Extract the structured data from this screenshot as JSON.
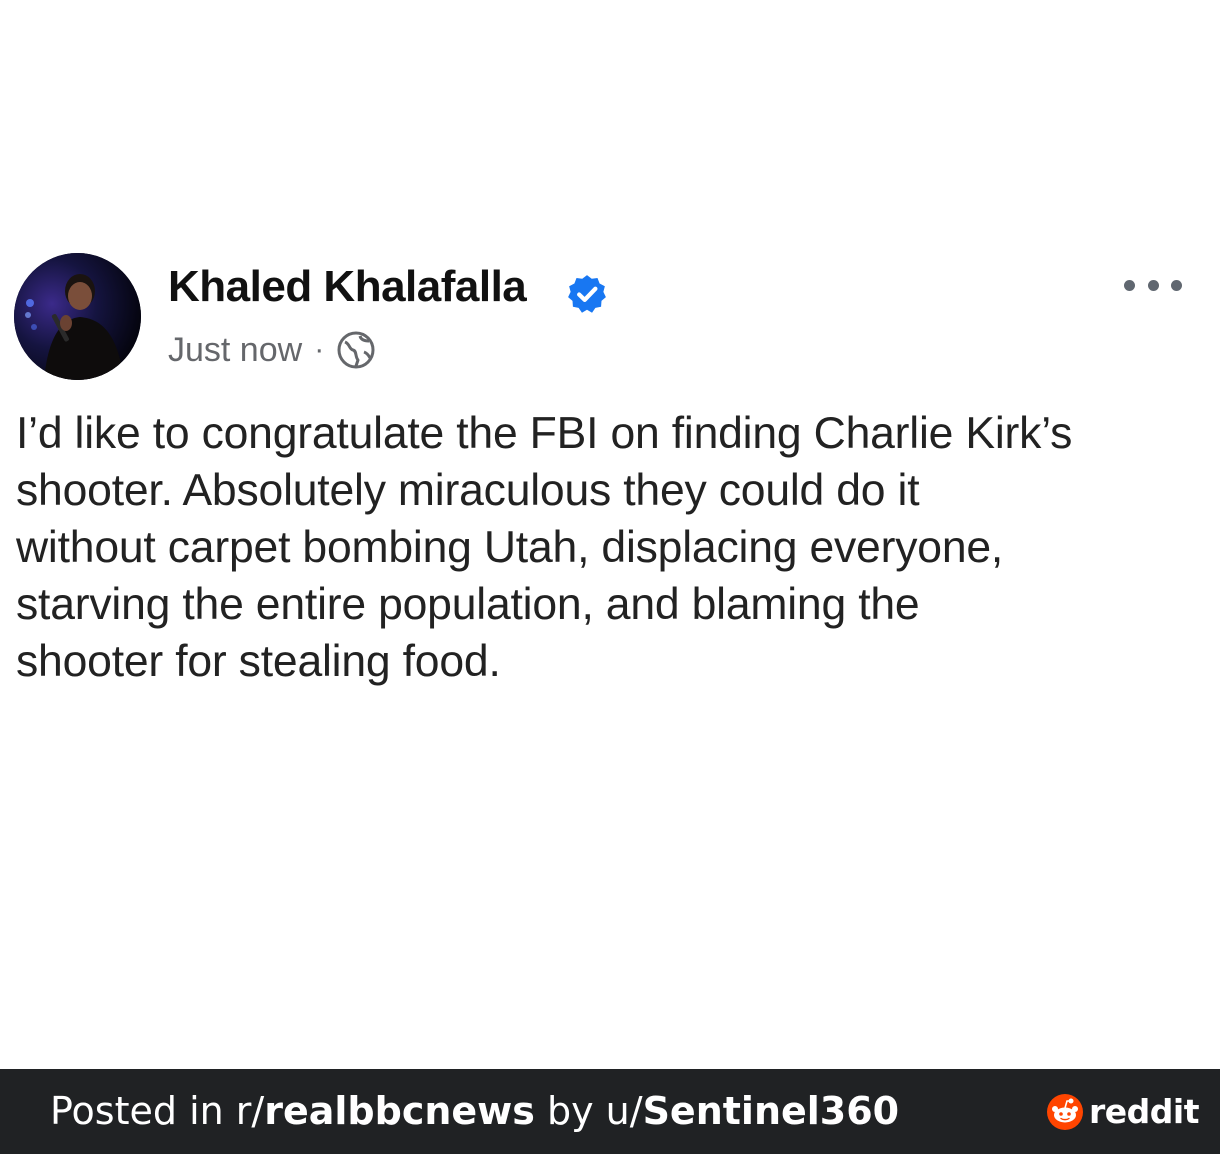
{
  "post": {
    "author": {
      "name": "Khaled Khalafalla",
      "verified": true
    },
    "timestamp": "Just now",
    "separator": "·",
    "audience_icon": "globe-icon",
    "more_icon": "more-options-icon",
    "text_lines": [
      "I’d like to congratulate the FBI on finding Charlie Kirk’s",
      "shooter. Absolutely miraculous they could do it",
      "without carpet bombing Utah, displacing everyone,",
      "starving the entire population, and blaming the",
      "shooter for stealing food."
    ]
  },
  "footer": {
    "prefix": "Posted in r/",
    "subreddit": "realbbcnews",
    "middle": " by u/",
    "username": "Sentinel360",
    "brand": "reddit",
    "brand_icon": "reddit-logo-icon"
  },
  "colors": {
    "verified_blue": "#1877f2",
    "footer_bg": "#202224",
    "reddit_orange": "#ff4500",
    "meta_gray": "#65676b"
  }
}
